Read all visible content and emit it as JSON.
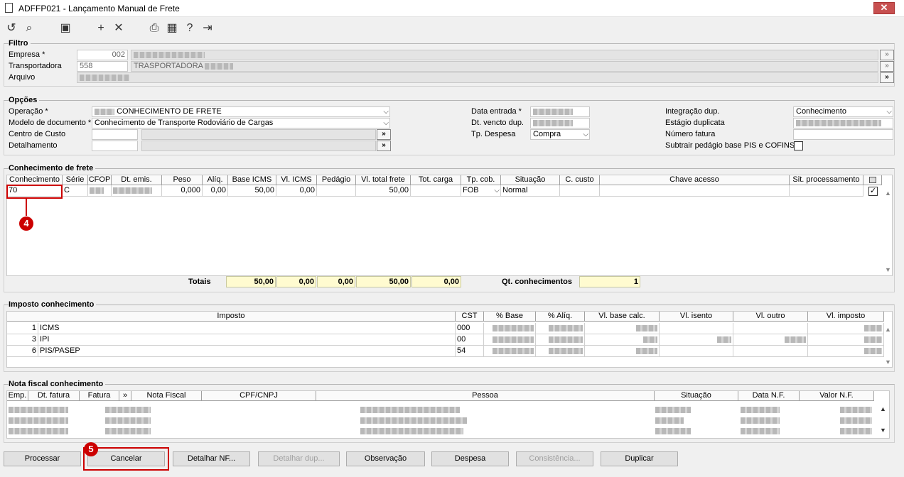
{
  "window": {
    "title": "ADFFP021 - Lançamento Manual de Frete",
    "close": "✕"
  },
  "filtro": {
    "title": "Filtro",
    "empresa_label": "Empresa *",
    "empresa_code": "002",
    "transportadora_label": "Transportadora",
    "transportadora_code": "558",
    "transportadora_name": "TRASPORTADORA",
    "arquivo_label": "Arquivo"
  },
  "opcoes": {
    "title": "Opções",
    "operacao_label": "Operação *",
    "operacao_value": "CONHECIMENTO DE FRETE",
    "modelo_label": "Modelo de documento *",
    "modelo_value": "Conhecimento de Transporte Rodoviário de Cargas",
    "centro_label": "Centro de Custo",
    "detalhamento_label": "Detalhamento",
    "data_entrada_label": "Data entrada *",
    "dt_vencto_label": "Dt. vencto dup.",
    "tp_despesa_label": "Tp. Despesa",
    "tp_despesa_value": "Compra",
    "integracao_label": "Integração dup.",
    "integracao_value": "Conhecimento",
    "estagio_label": "Estágio duplicata",
    "numero_fatura_label": "Número fatura",
    "subtrair_label": "Subtrair pedágio base PIS e COFINS"
  },
  "conhecimento": {
    "title": "Conhecimento de frete",
    "headers": [
      "Conhecimento",
      "Série",
      "CFOP",
      "Dt. emis.",
      "Peso",
      "Alíq.",
      "Base ICMS",
      "Vl. ICMS",
      "Pedágio",
      "Vl. total frete",
      "Tot. carga",
      "Tp. cob.",
      "Situação",
      "C. custo",
      "Chave acesso",
      "Sit. processamento"
    ],
    "row": {
      "conhecimento": "70",
      "serie": "C",
      "peso": "0,000",
      "aliq": "0,00",
      "base_icms": "50,00",
      "vl_icms": "0,00",
      "vl_total": "50,00",
      "tp_cob": "FOB",
      "situacao": "Normal",
      "checked": "✓"
    },
    "totais_label": "Totais",
    "totais": {
      "base_icms": "50,00",
      "vl_icms": "0,00",
      "pedagio": "0,00",
      "vl_total": "50,00",
      "tot_carga": "0,00"
    },
    "qt_label": "Qt. conhecimentos",
    "qt_value": "1",
    "callout": "4"
  },
  "imposto": {
    "title": "Imposto conhecimento",
    "headers": [
      "Imposto",
      "CST",
      "% Base",
      "% Alíq.",
      "Vl. base calc.",
      "Vl. isento",
      "Vl. outro",
      "Vl. imposto"
    ],
    "rows": [
      {
        "num": "1",
        "name": "ICMS",
        "cst": "000"
      },
      {
        "num": "3",
        "name": "IPI",
        "cst": "00"
      },
      {
        "num": "6",
        "name": "PIS/PASEP",
        "cst": "54"
      }
    ]
  },
  "nota": {
    "title": "Nota fiscal conhecimento",
    "headers": [
      "Emp.",
      "Dt. fatura",
      "Fatura",
      "»",
      "Nota Fiscal",
      "CPF/CNPJ",
      "Pessoa",
      "Situação",
      "Data N.F.",
      "Valor N.F."
    ]
  },
  "buttons": {
    "processar": "Processar",
    "cancelar": "Cancelar",
    "detalhar_nf": "Detalhar NF...",
    "detalhar_dup": "Detalhar dup...",
    "observacao": "Observação",
    "despesa": "Despesa",
    "consistencia": "Consistência...",
    "duplicar": "Duplicar",
    "callout": "5"
  },
  "colors": {
    "highlight_red": "#cc0000",
    "totals_bg": "#fffbd0"
  }
}
